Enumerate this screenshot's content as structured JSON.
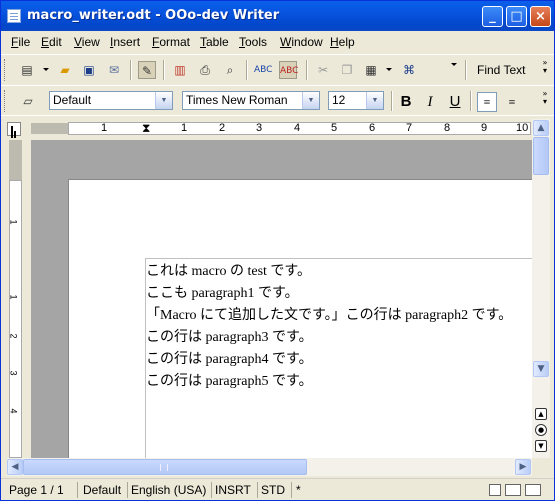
{
  "window": {
    "title": "macro_writer.odt - OOo-dev Writer",
    "buttons": {
      "minimize": "_",
      "maximize": "□",
      "close": "×"
    }
  },
  "menubar": [
    "File",
    "Edit",
    "View",
    "Insert",
    "Format",
    "Table",
    "Tools",
    "Window",
    "Help"
  ],
  "standard_toolbar": {
    "find_text_label": "Find Text"
  },
  "formatting_toolbar": {
    "paragraph_style": "Default",
    "font_name": "Times New Roman",
    "font_size": "12",
    "bold_label": "B",
    "italic_label": "I",
    "underline_label": "U"
  },
  "ruler": {
    "numbers": [
      "1",
      "1",
      "2",
      "3",
      "4",
      "5",
      "6",
      "7",
      "8",
      "9",
      "10"
    ],
    "vnumbers": [
      "1",
      "1",
      "2",
      "3",
      "4"
    ]
  },
  "document": {
    "paragraphs": [
      "これは macro の test です。",
      "ここも paragraph1 です。",
      "「Macro にて追加した文です。」この行は paragraph2 です。",
      "この行は paragraph3 です。",
      "この行は paragraph4 です。",
      "この行は paragraph5 です。"
    ]
  },
  "statusbar": {
    "page": "Page 1 / 1",
    "style": "Default",
    "language": "English (USA)",
    "insert_mode": "INSRT",
    "selection_mode": "STD",
    "modified": "*"
  },
  "colors": {
    "title_bar": "#0a5fe8",
    "chrome": "#ece9d8",
    "doc_background": "#a5a5a5"
  }
}
